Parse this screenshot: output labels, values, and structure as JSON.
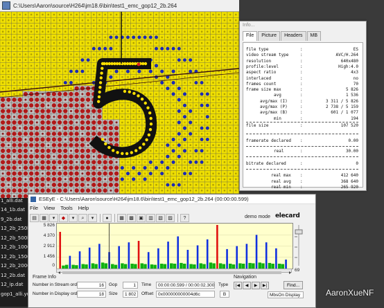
{
  "filelist": [
    "-15_2b.dat",
    "1_alli.dat",
    "14_1b.dat",
    "9_2b.dat",
    "12_2b_250k.",
    "12_2b_500k.",
    "12_2b_1000k",
    "12_2b_1500k",
    "12_2b_2000k",
    "12_2b.dat",
    "12_ip.dat",
    "gop1_alli.yuv"
  ],
  "mbwindow": {
    "title": "C:\\Users\\Aaron\\source\\H264\\jm18.6\\bin\\test1_emc_gop12_2b.264"
  },
  "info": {
    "title": "Info...",
    "tabs": [
      "File",
      "Picture",
      "Headers",
      "MB"
    ],
    "rows": [
      {
        "k": "file type",
        "v": "ES"
      },
      {
        "k": "video stream type",
        "v": "AVC/H.264"
      },
      {
        "k": "resolution",
        "v": "640x480"
      },
      {
        "k": "profile:level",
        "v": "High:4.0"
      },
      {
        "k": "aspect ratio",
        "v": "4x3"
      },
      {
        "k": "interlaced",
        "v": "no"
      },
      {
        "k": "frames count",
        "v": "70"
      },
      {
        "k": "frame size max",
        "v": "5 826"
      },
      {
        "k": "avg",
        "v": "1 536"
      },
      {
        "k": "avg/max (I)",
        "v": "3 311 / 5 826"
      },
      {
        "k": "avg/max (P)",
        "v": "2 738 / 5 159"
      },
      {
        "k": "avg/max (B)",
        "v": "601 / 1 077"
      },
      {
        "k": "min",
        "v": "194"
      },
      {
        "k": "file size",
        "v": "107 520"
      }
    ],
    "framerate_declared_label": "framerate declared",
    "framerate_declared": "0.00",
    "real_label": "real",
    "real": "30.00",
    "bitrate_declared_label": "bitrate declared",
    "bitrate_declared": "0",
    "bitrate_rows": [
      {
        "k": "real max",
        "v": "412 640"
      },
      {
        "k": "real avg",
        "v": "368 640"
      },
      {
        "k": "real min",
        "v": "265 920"
      }
    ]
  },
  "ese": {
    "title": "ESEyE - C:\\Users\\Aaron\\source\\H264\\jm18.6\\bin\\test1_emc_gop12_2b.264 (00:00:00.599)",
    "menu": [
      "File",
      "View",
      "Tools",
      "Help"
    ],
    "demo_mode": "demo mode",
    "logo": "elecard",
    "ymax": 5826,
    "yticks": [
      "5 826",
      "4 370",
      "2 912",
      "1 456",
      "0"
    ],
    "scroll_value": "69",
    "frame_info_label": "Frame Info",
    "navigation_label": "Navigation",
    "f_stream_label": "Number in Stream order",
    "f_stream": "16",
    "f_display_label": "Number in Display order",
    "f_display": "18",
    "gop_label": "Gop",
    "gop": "1",
    "size_label": "Size",
    "size": "1 802",
    "time_label": "Time",
    "time": "00:00:00.599 / 00:00:02.300",
    "offset_label": "Offset",
    "offset": "0x000000000004d6c",
    "type_label": "Type",
    "type": "B",
    "find_label": "Find...",
    "mode_select": "MbsOn Display"
  },
  "colors": {
    "I": "#e01010",
    "P": "#1030e0",
    "B": "#10b010",
    "grid_blue": "#1c2ab4",
    "grid_red": "#b01818",
    "grid_yellow": "#f0e000"
  },
  "chart_data": {
    "type": "bar",
    "x": [
      1,
      2,
      3,
      4,
      5,
      6,
      7,
      8,
      9,
      10,
      11,
      12,
      13,
      14,
      15,
      16,
      17,
      18,
      19,
      20,
      21,
      22,
      23,
      24,
      25,
      26,
      27,
      28,
      29,
      30,
      31,
      32,
      33,
      34,
      35,
      36,
      37,
      38,
      39,
      40,
      41,
      42,
      43,
      44,
      45,
      46,
      47,
      48,
      49,
      50,
      51,
      52,
      53,
      54,
      55,
      56,
      57,
      58,
      59,
      60,
      61,
      62,
      63,
      64,
      65,
      66,
      67,
      68,
      69,
      70
    ],
    "frame_types": [
      "I",
      "B",
      "B",
      "P",
      "B",
      "B",
      "P",
      "B",
      "B",
      "P",
      "B",
      "B",
      "P",
      "B",
      "B",
      "P",
      "B",
      "B",
      "P",
      "B",
      "B",
      "P",
      "B",
      "B",
      "I",
      "B",
      "B",
      "P",
      "B",
      "B",
      "P",
      "B",
      "B",
      "P",
      "B",
      "B",
      "P",
      "B",
      "B",
      "P",
      "B",
      "B",
      "P",
      "B",
      "B",
      "P",
      "B",
      "B",
      "I",
      "B",
      "B",
      "P",
      "B",
      "B",
      "P",
      "B",
      "B",
      "P",
      "B",
      "B",
      "P",
      "B",
      "B",
      "P",
      "B",
      "B",
      "P",
      "B",
      "B",
      "P"
    ],
    "values": [
      4900,
      400,
      500,
      1700,
      500,
      450,
      2300,
      600,
      550,
      2800,
      700,
      600,
      3300,
      800,
      700,
      2200,
      600,
      500,
      3000,
      700,
      600,
      3500,
      650,
      600,
      3700,
      700,
      600,
      2200,
      550,
      500,
      2700,
      650,
      600,
      3600,
      700,
      650,
      4300,
      750,
      650,
      2500,
      600,
      550,
      3100,
      700,
      600,
      3900,
      800,
      700,
      5826,
      700,
      600,
      2600,
      650,
      550,
      3000,
      700,
      650,
      3300,
      750,
      700,
      4500,
      800,
      700,
      3500,
      750,
      650,
      2700,
      650,
      600,
      1200
    ],
    "series": [
      {
        "name": "I"
      },
      {
        "name": "P"
      },
      {
        "name": "B"
      }
    ],
    "ylim": [
      0,
      5826
    ]
  }
}
